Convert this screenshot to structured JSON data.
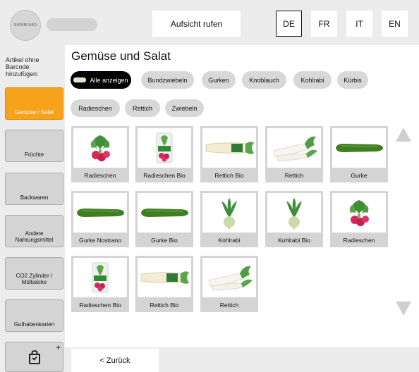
{
  "header": {
    "logo_text": "SUPERCARD",
    "call_label": "Aufsicht rufen",
    "languages": [
      {
        "code": "DE",
        "active": true
      },
      {
        "code": "FR",
        "active": false
      },
      {
        "code": "IT",
        "active": false
      },
      {
        "code": "EN",
        "active": false
      }
    ]
  },
  "sidebar": {
    "label": "Artikel ohne Barcode hinzufügen:",
    "categories": [
      {
        "label": "Gemüse / Salat",
        "active": true
      },
      {
        "label": "Früchte",
        "active": false
      },
      {
        "label": "Backwaren",
        "active": false
      },
      {
        "label": "Andere Nahrungsmittel",
        "active": false
      },
      {
        "label": "CO2 Zylinder / Müllsäcke",
        "active": false
      },
      {
        "label": "Guthabenkarten",
        "active": false
      }
    ],
    "cart_icon": "shopping-bag-icon",
    "cart_plus": "+"
  },
  "main": {
    "title": "Gemüse und Salat",
    "filters": [
      {
        "label": "Alle anzeigen",
        "active": true
      },
      {
        "label": "Bundzwiebeln",
        "active": false
      },
      {
        "label": "Gurken",
        "active": false
      },
      {
        "label": "Knoblauch",
        "active": false
      },
      {
        "label": "Kohlrabi",
        "active": false
      },
      {
        "label": "Kürbis",
        "active": false
      },
      {
        "label": "Radieschen",
        "active": false
      },
      {
        "label": "Rettich",
        "active": false
      },
      {
        "label": "Zwiebeln",
        "active": false
      }
    ],
    "products": [
      {
        "label": "Radieschen",
        "image": "radish-bunch"
      },
      {
        "label": "Radieschen Bio",
        "image": "radish-bag"
      },
      {
        "label": "Rettich Bio",
        "image": "white-radish-bio"
      },
      {
        "label": "Rettich",
        "image": "white-radish"
      },
      {
        "label": "Gurke",
        "image": "cucumber"
      },
      {
        "label": "Gurke Nostrano",
        "image": "cucumber"
      },
      {
        "label": "Gurke Bio",
        "image": "cucumber"
      },
      {
        "label": "Kohlrabi",
        "image": "kohlrabi"
      },
      {
        "label": "Kohlrabi Bio",
        "image": "kohlrabi"
      },
      {
        "label": "Radieschen",
        "image": "radish-bunch"
      },
      {
        "label": "Radieschen Bio",
        "image": "radish-bag"
      },
      {
        "label": "Rettich Bio",
        "image": "white-radish-bio"
      },
      {
        "label": "Rettich",
        "image": "white-radish"
      }
    ],
    "scroll_up_icon": "triangle-up-icon",
    "scroll_down_icon": "triangle-down-icon"
  },
  "footer": {
    "back_label": "< Zurück"
  },
  "colors": {
    "accent": "#f7a21b",
    "background": "#ececec",
    "tile": "#d4d4d4"
  }
}
